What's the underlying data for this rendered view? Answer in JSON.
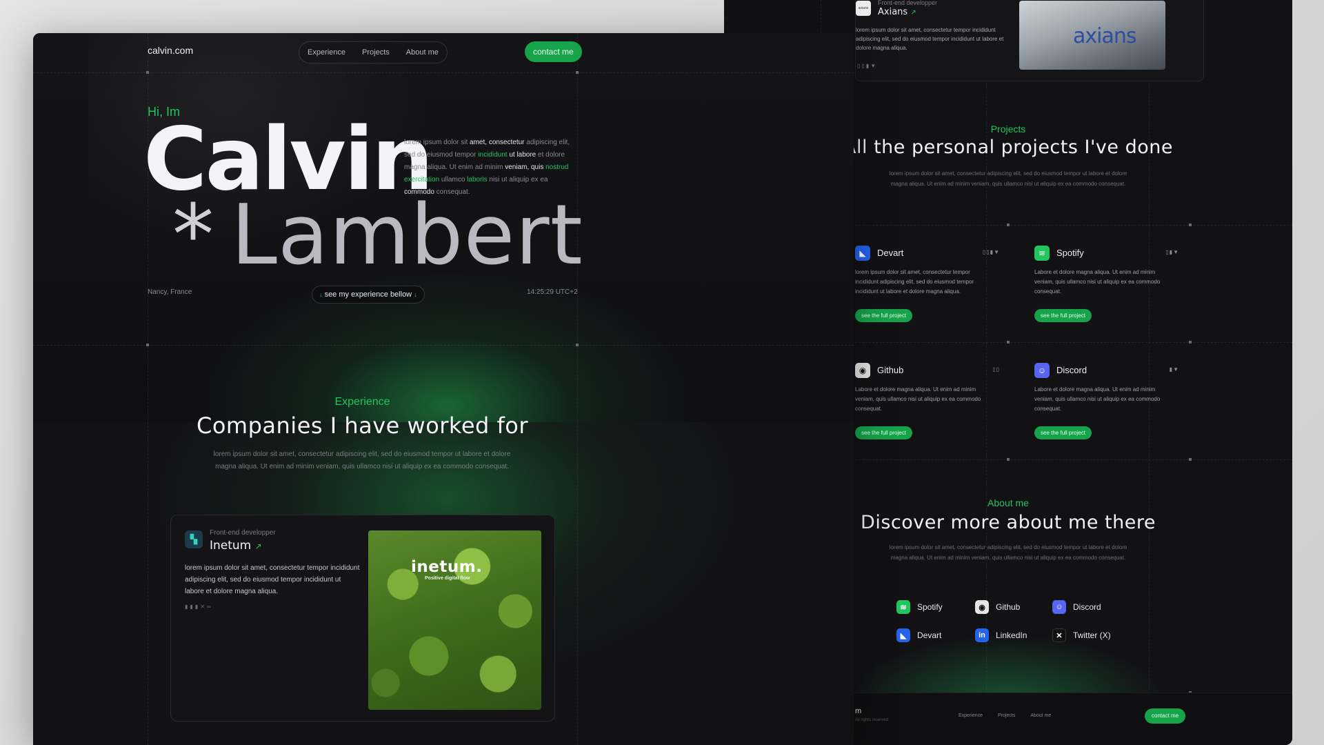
{
  "right": {
    "axians": {
      "logo_text": "axians",
      "role": "Front-end developper",
      "name": "Axians",
      "arrow": "↗",
      "desc": "lorem ipsum dolor sit amet, consectetur tempor incididunt adipiscing elit, sed do eiusmod tempor incididunt ut labore et dolore magna aliqua.",
      "mini_icons": "▯▯▮▼",
      "photo_text": "axians"
    },
    "projects_section": {
      "kicker": "Projects",
      "title": "All the personal projects I've done",
      "subtitle": "lorem ipsum dolor sit amet, consectetur adipiscing elit, sed do eiusmod tempor ut labore et dolore magna aliqua. Ut enim ad minim veniam, quis ullamco nisi ut aliquip ex ea commodo consequat."
    },
    "projects": [
      {
        "name": "Devart",
        "icon": "devart-icon",
        "tags": "▯▯▮▼",
        "desc": "lorem ipsum dolor sit amet, consectetur tempor incididunt adipiscing elit, sed do eiusmod tempor incididunt ut labore et dolore magna aliqua.",
        "button": "see the full project"
      },
      {
        "name": "Spotify",
        "icon": "spotify-icon",
        "tags": "▯▮▼",
        "desc": "Labore et dolore magna aliqua. Ut enim ad minim veniam, quis ullamco nisi ut aliquip ex ea commodo consequat.",
        "button": "see the full project"
      },
      {
        "name": "Github",
        "icon": "github-icon",
        "tags": "▯▯",
        "desc": "Labore et dolore magna aliqua. Ut enim ad minim veniam, quis ullamco nisi ut aliquip ex ea commodo consequat.",
        "button": "see the full project"
      },
      {
        "name": "Discord",
        "icon": "discord-icon",
        "tags": "▮▼",
        "desc": "Labore et dolore magna aliqua. Ut enim ad minim veniam, quis ullamco nisi ut aliquip ex ea commodo consequat.",
        "button": "see the full project"
      }
    ],
    "about": {
      "kicker": "About me",
      "title": "Discover more about me there",
      "subtitle": "lorem ipsum dolor sit amet, consectetur adipiscing elit, sed do eiusmod tempor ut labore et dolore magna aliqua. Ut enim ad minim veniam, quis ullamco nisi ut aliquip ex ea commodo consequat."
    },
    "socials": [
      {
        "label": "Spotify",
        "icon": "spotify-icon",
        "color": "#22c55e"
      },
      {
        "label": "Github",
        "icon": "github-icon",
        "color": "#e5e5e5"
      },
      {
        "label": "Discord",
        "icon": "discord-icon",
        "color": "#5865f2"
      },
      {
        "label": "Devart",
        "icon": "devart-icon",
        "color": "#2563eb"
      },
      {
        "label": "LinkedIn",
        "icon": "linkedin-icon",
        "color": "#2563eb"
      },
      {
        "label": "Twitter (X)",
        "icon": "x-icon",
        "color": "#111111"
      }
    ],
    "footer": {
      "logo": "m",
      "copyright": "All rights reserved",
      "nav": [
        "Experience",
        "Projects",
        "About me"
      ],
      "contact": "contact me"
    }
  },
  "site": {
    "logo": "calvin.com",
    "nav": [
      "Experience",
      "Projects",
      "About me"
    ],
    "contact": "contact me"
  },
  "hero": {
    "greeting": "Hi, Im",
    "first_name": "Calvin",
    "star": "*",
    "last_name": "Lambert",
    "intro_parts": [
      {
        "t": "lorem ipsum dolor sit ",
        "s": "n"
      },
      {
        "t": "amet, consectetur",
        "s": "b"
      },
      {
        "t": " adipiscing elit, sed do eiusmod tempor ",
        "s": "n"
      },
      {
        "t": "incididunt",
        "s": "g"
      },
      {
        "t": " ut labore",
        "s": "b"
      },
      {
        "t": " et dolore magna aliqua. Ut enim ad minim ",
        "s": "n"
      },
      {
        "t": "veniam, quis",
        "s": "b"
      },
      {
        "t": " ",
        "s": "n"
      },
      {
        "t": "nostrud exercitation",
        "s": "g"
      },
      {
        "t": " ullamco ",
        "s": "n"
      },
      {
        "t": "laboris",
        "s": "g"
      },
      {
        "t": " nisi ut aliquip ex ea ",
        "s": "n"
      },
      {
        "t": "commodo",
        "s": "b"
      },
      {
        "t": " consequat.",
        "s": "n"
      }
    ],
    "location": "Nancy, France",
    "cta": "see my experience bellow",
    "arrow": "↓",
    "time": "14:25:29 UTC+2"
  },
  "experience": {
    "kicker": "Experience",
    "title": "Companies I have worked for",
    "subtitle": "lorem ipsum dolor sit amet, consectetur adipiscing elit, sed do eiusmod tempor  ut labore et dolore magna aliqua. Ut enim ad minim veniam, quis ullamco nisi ut aliquip ex ea commodo consequat.",
    "card": {
      "role": "Front-end developper",
      "name": "Inetum",
      "arrow": "↗",
      "desc": "lorem ipsum dolor sit amet, consectetur tempor incididunt adipiscing elit, sed do eiusmod tempor incididunt ut labore et dolore magna aliqua.",
      "mini_icons": "▮▮▮✕∞",
      "photo_brand": "inetum.",
      "photo_tag": "Positive digital flow"
    }
  },
  "colors": {
    "accent": "#22c55e",
    "button": "#16a34a",
    "background": "#121215"
  }
}
